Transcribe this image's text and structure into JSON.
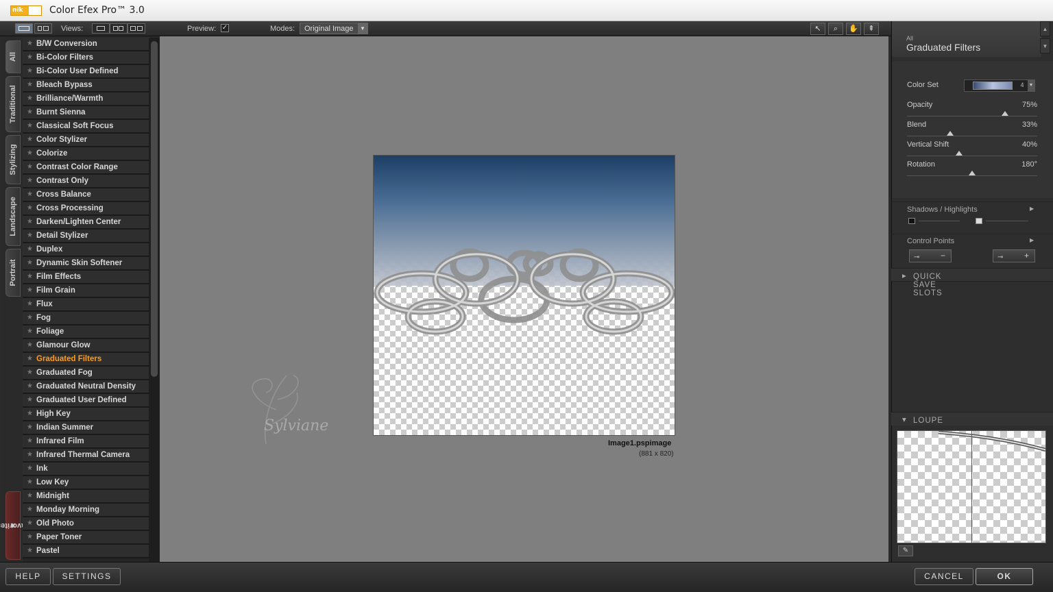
{
  "window": {
    "title": "Color Efex Pro™ 3.0",
    "logo_text": "nik"
  },
  "toolbar": {
    "views_label": "Views:",
    "preview_label": "Preview:",
    "preview_checked": "✓",
    "modes_label": "Modes:",
    "mode_value": "Original Image"
  },
  "tabs": [
    "All",
    "Traditional",
    "Stylizing",
    "Landscape",
    "Portrait",
    "Favorites"
  ],
  "filters": [
    "B/W Conversion",
    "Bi-Color Filters",
    "Bi-Color User Defined",
    "Bleach Bypass",
    "Brilliance/Warmth",
    "Burnt Sienna",
    "Classical Soft Focus",
    "Color Stylizer",
    "Colorize",
    "Contrast Color Range",
    "Contrast Only",
    "Cross Balance",
    "Cross Processing",
    "Darken/Lighten Center",
    "Detail Stylizer",
    "Duplex",
    "Dynamic Skin Softener",
    "Film Effects",
    "Film Grain",
    "Flux",
    "Fog",
    "Foliage",
    "Glamour Glow",
    "Graduated Filters",
    "Graduated Fog",
    "Graduated Neutral Density",
    "Graduated User Defined",
    "High Key",
    "Indian Summer",
    "Infrared Film",
    "Infrared Thermal Camera",
    "Ink",
    "Low Key",
    "Midnight",
    "Monday Morning",
    "Old Photo",
    "Paper Toner",
    "Pastel"
  ],
  "active_filter": "Graduated Filters",
  "image": {
    "name": "Image1.pspimage",
    "size": "(881 x 820)"
  },
  "panel": {
    "category": "All",
    "filter_name": "Graduated Filters",
    "color_set_label": "Color Set",
    "color_set_value": "4",
    "controls": [
      {
        "label": "Opacity",
        "value": "75%",
        "level": 0.75
      },
      {
        "label": "Blend",
        "value": "33%",
        "level": 0.33
      },
      {
        "label": "Vertical Shift",
        "value": "40%",
        "level": 0.4
      },
      {
        "label": "Rotation",
        "value": "180°",
        "level": 0.5
      }
    ],
    "shadows_highlights": "Shadows / Highlights",
    "control_points": "Control Points",
    "cp_minus": "−",
    "cp_plus": "+",
    "quick_save": "QUICK SAVE SLOTS",
    "loupe": "LOUPE"
  },
  "buttons": {
    "help": "HELP",
    "settings": "SETTINGS",
    "cancel": "CANCEL",
    "ok": "OK"
  },
  "watermark": "Sylviane"
}
